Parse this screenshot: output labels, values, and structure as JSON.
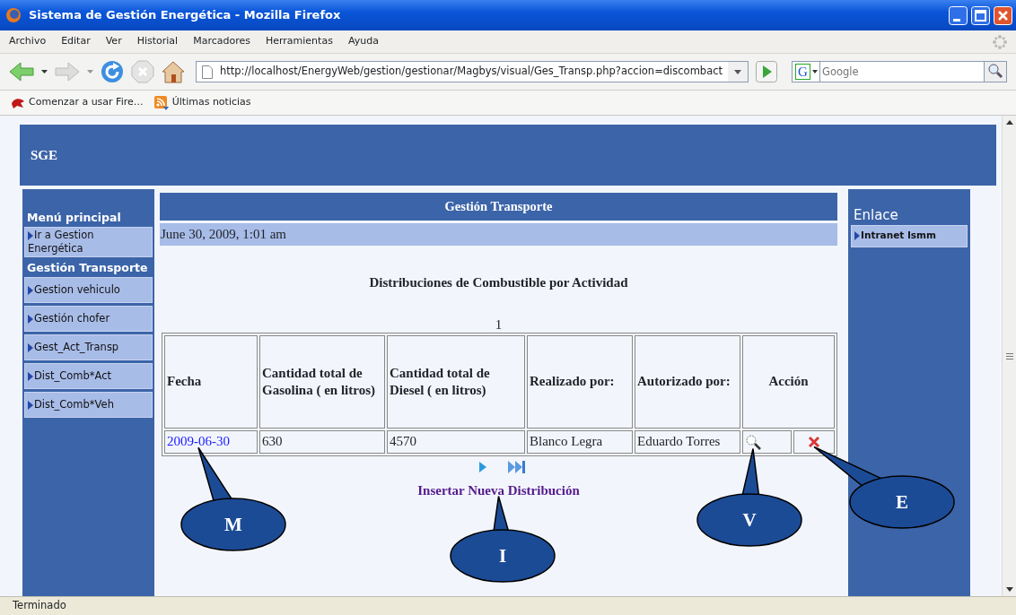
{
  "window": {
    "title": "Sistema de Gestión Energética - Mozilla Firefox"
  },
  "menu_bar": [
    "Archivo",
    "Editar",
    "Ver",
    "Historial",
    "Marcadores",
    "Herramientas",
    "Ayuda"
  ],
  "toolbar": {
    "url": "http://localhost/EnergyWeb/gestion/gestionar/Magbys/visual/Ges_Transp.php?accion=discombact",
    "search": {
      "engine_logo": "G",
      "placeholder": "Google"
    }
  },
  "bookmarks": [
    "Comenzar a usar Fire…",
    "Últimas noticias"
  ],
  "page": {
    "header": "SGE",
    "left_menu": [
      {
        "title": "Menú principal",
        "items": [
          "Ir a Gestion Energética"
        ]
      },
      {
        "title": "Gestión Transporte",
        "items": [
          "Gestion vehiculo",
          "Gestión chofer",
          "Gest_Act_Transp",
          "Dist_Comb*Act",
          "Dist_Comb*Veh"
        ]
      }
    ],
    "right_menu": {
      "title": "Enlace",
      "items": [
        "Intranet Ismm"
      ]
    },
    "main": {
      "title": "Gestión Transporte",
      "date": "June 30, 2009, 1:01 am",
      "heading": "Distribuciones de Combustible por Actividad",
      "page_number": "1",
      "table": {
        "columns": [
          "Fecha",
          "Cantidad total de Gasolina ( en litros)",
          "Cantidad total de Diesel ( en litros)",
          "Realizado por:",
          "Autorizado por:",
          "Acción"
        ],
        "rows": [
          {
            "date": "2009-06-30",
            "gasoline": "630",
            "diesel": "4570",
            "done_by": "Blanco Legra",
            "authorized_by": "Eduardo Torres"
          }
        ]
      },
      "insert_link": "Insertar Nueva Distribución"
    }
  },
  "callouts": [
    {
      "label": "M"
    },
    {
      "label": "V"
    },
    {
      "label": "E"
    },
    {
      "label": "I"
    }
  ],
  "status_bar": "Terminado"
}
